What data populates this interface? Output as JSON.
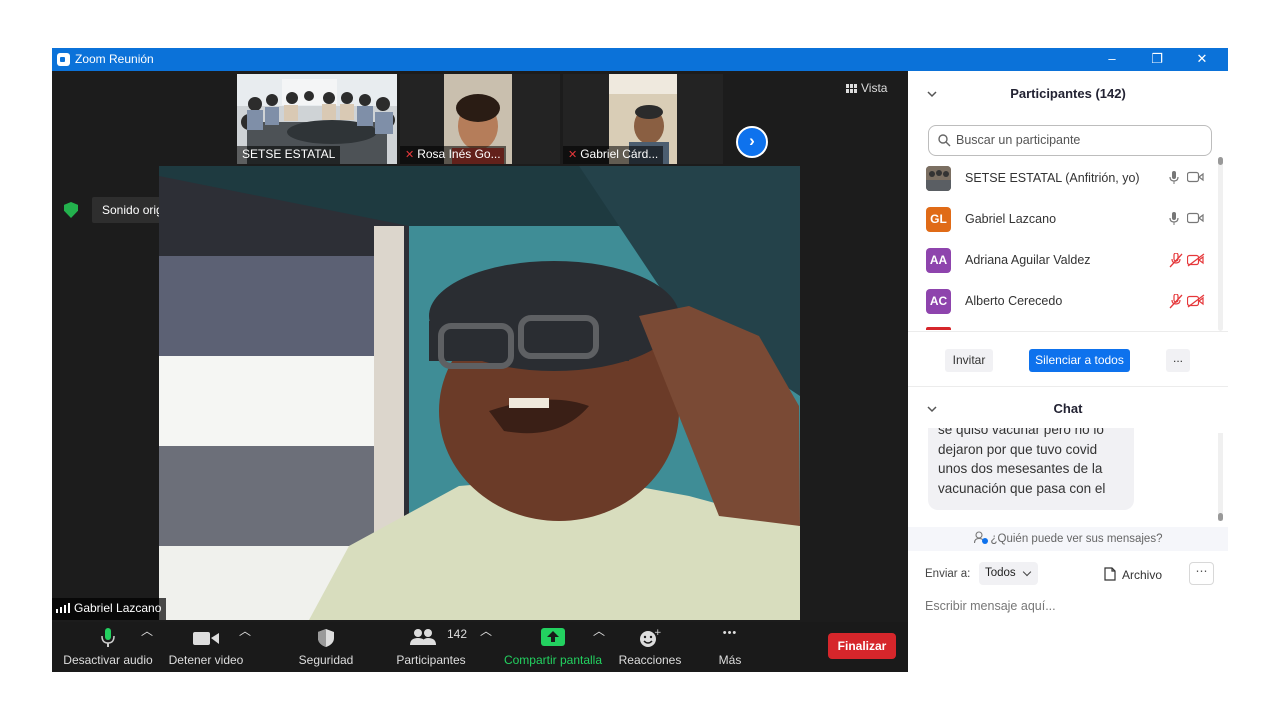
{
  "window": {
    "title": "Zoom Reunión",
    "min_glyph": "–",
    "max_glyph": "❐",
    "close_glyph": "✕"
  },
  "thumbnails": [
    {
      "name": "SETSE ESTATAL",
      "muted": false
    },
    {
      "name": "Rosa Inés Go...",
      "muted": true
    },
    {
      "name": "Gabriel Cárd...",
      "muted": true
    }
  ],
  "video": {
    "next_glyph": "›",
    "view_label": "Vista",
    "original_sound_label": "Sonido original: desactivado",
    "active_speaker": "Gabriel Lazcano"
  },
  "toolbar": {
    "mute_label": "Desactivar audio",
    "video_label": "Detener video",
    "security_label": "Seguridad",
    "participants_label": "Participantes",
    "participants_count": "142",
    "share_label": "Compartir pantalla",
    "reactions_label": "Reacciones",
    "more_label": "Más",
    "more_glyph": "•••",
    "end_label": "Finalizar"
  },
  "participants_panel": {
    "title": "Participantes (142)",
    "search_placeholder": "Buscar un participante",
    "rows": [
      {
        "initials": "",
        "name": "SETSE ESTATAL (Anfitrión, yo)",
        "muted": false,
        "video_off": false
      },
      {
        "initials": "GL",
        "name": "Gabriel Lazcano",
        "muted": false,
        "video_off": false
      },
      {
        "initials": "AA",
        "name": "Adriana Aguilar Valdez",
        "muted": true,
        "video_off": true
      },
      {
        "initials": "AC",
        "name": "Alberto Cerecedo",
        "muted": true,
        "video_off": true
      }
    ],
    "invite_label": "Invitar",
    "mute_all_label": "Silenciar a todos",
    "more_label": "..."
  },
  "chat": {
    "title": "Chat",
    "message_lines": [
      "se quiso vacunar pero no lo",
      "dejaron por que tuvo covid",
      "unos dos mesesantes de la",
      "vacunación que pasa con el"
    ],
    "who_can_see": "¿Quién puede ver sus mensajes?",
    "send_to_label": "Enviar a:",
    "recipient": "Todos",
    "file_label": "Archivo",
    "more_glyph": "⋯",
    "input_placeholder": "Escribir mensaje aquí..."
  },
  "colors": {
    "titlebar": "#0b72d9",
    "accent_blue": "#0e72ed",
    "share_green": "#23d160",
    "end_red": "#d6262b",
    "muted_red": "#e5383b",
    "avatar_orange": "#e06b17",
    "avatar_purple": "#8e44ad"
  }
}
